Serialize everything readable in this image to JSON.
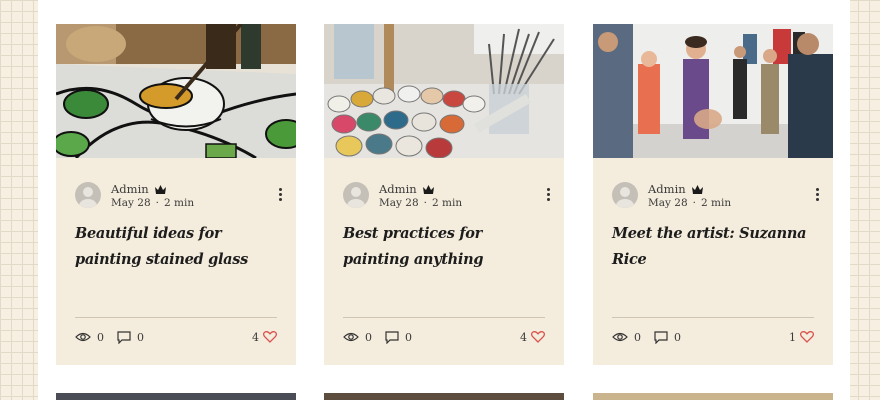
{
  "posts": [
    {
      "author": "Admin",
      "date": "May 28",
      "read_time": "2 min",
      "title": "Beautiful ideas for painting stained glass",
      "views": "0",
      "comments": "0",
      "likes": "4",
      "image": "stained-glass-painting"
    },
    {
      "author": "Admin",
      "date": "May 28",
      "read_time": "2 min",
      "title": "Best practices for painting anything",
      "views": "0",
      "comments": "0",
      "likes": "4",
      "image": "paint-jars-and-brushes"
    },
    {
      "author": "Admin",
      "date": "May 28",
      "read_time": "2 min",
      "title": "Meet the artist: Suzanna Rice",
      "views": "0",
      "comments": "0",
      "likes": "1",
      "image": "gallery-crowd"
    }
  ],
  "separator": "·",
  "colors": {
    "card_bg": "#f4ecdc",
    "page_bg": "#f6efe2",
    "heart": "#d9534f",
    "text": "#3b3b3b"
  },
  "icons": [
    "crown-icon",
    "more-icon",
    "eye-icon",
    "comment-icon",
    "heart-icon",
    "avatar-icon"
  ]
}
